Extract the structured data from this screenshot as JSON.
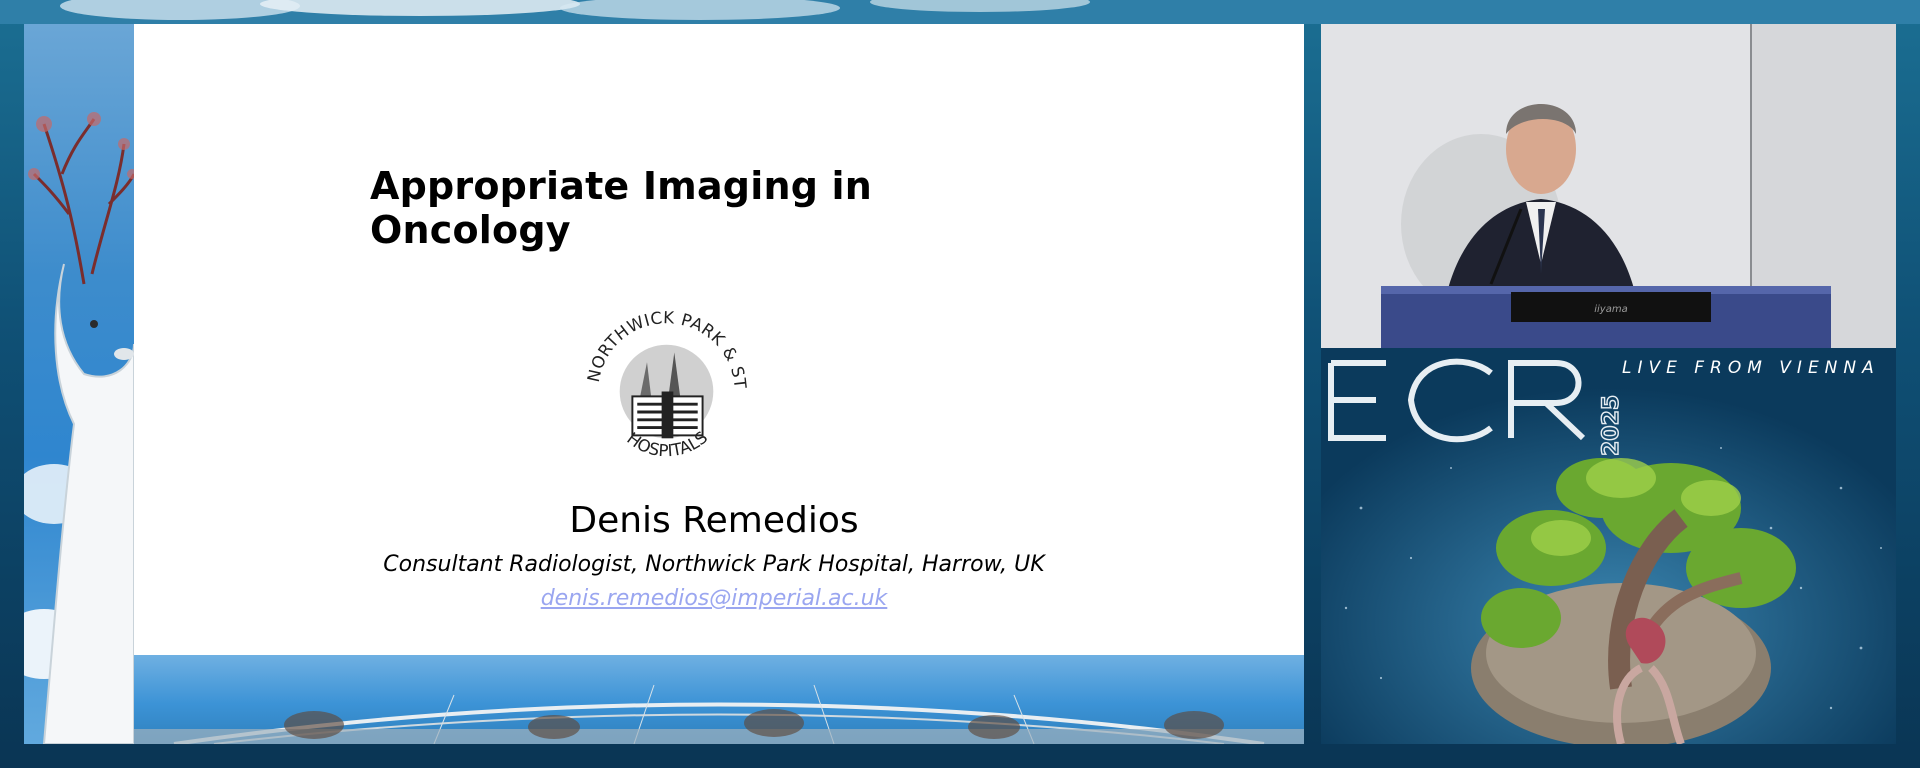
{
  "slide": {
    "title": "Appropriate Imaging in Oncology",
    "logo": {
      "top_arc": "NORTHWICK PARK & ST MARK'S",
      "bottom_arc": "HOSPITALS",
      "icon": "hospital-building-icon"
    },
    "presenter_name": "Denis Remedios",
    "presenter_role": "Consultant Radiologist, Northwick Park Hospital, Harrow, UK",
    "presenter_email": "denis.remedios@imperial.ac.uk"
  },
  "speaker_video": {
    "monitor_brand": "iiyama"
  },
  "branding": {
    "logo_letters": "ECR",
    "year": "2025",
    "tagline": "LIVE FROM VIENNA"
  },
  "colors": {
    "background": "#0f4f74",
    "link": "#9aa6f0",
    "slide_panel": "#3d8ccc"
  }
}
